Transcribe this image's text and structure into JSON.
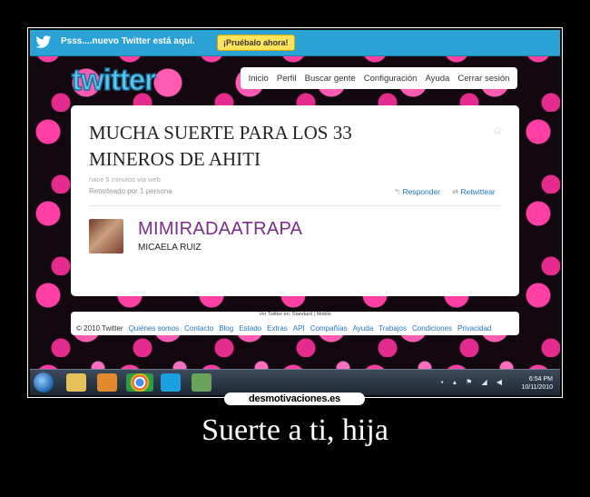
{
  "notification": {
    "text": "Psss....nuevo Twitter está aquí.",
    "button_label": "¡Pruébalo ahora!"
  },
  "logo_text": "twitter",
  "nav": {
    "items": [
      "Inicio",
      "Perfil",
      "Buscar gente",
      "Configuración",
      "Ayuda",
      "Cerrar sesión"
    ]
  },
  "tweet": {
    "text": "MUCHA SUERTE PARA LOS 33 MINEROS DE AHITI",
    "meta_time": "hace 5 minutos vía web",
    "retweeted_by": "Retwiteado por 1 persona",
    "reply_label": "Responder",
    "retweet_label": "Retwittear",
    "username": "MIMIRADAATRAPA",
    "real_name": "MICAELA RUIZ"
  },
  "version_text": "Ver Twitter en: Standard | Mobile",
  "footer": {
    "copyright": "© 2010 Twitter",
    "links": [
      "Quiénes somos",
      "Contacto",
      "Blog",
      "Estado",
      "Extras",
      "API",
      "Compañías",
      "Ayuda",
      "Trabajos",
      "Condiciones",
      "Privacidad"
    ]
  },
  "taskbar": {
    "time": "6:54 PM",
    "date": "10/11/2010"
  },
  "watermark": "desmotivaciones.es",
  "caption": "Suerte a ti, hija",
  "colors": {
    "twitter_blue": "#2aa2d6",
    "try_button": "#ffe35a",
    "username_purple": "#7a2d8c",
    "link_blue": "#2276bb",
    "heart_pink": "#ff3fa3"
  }
}
